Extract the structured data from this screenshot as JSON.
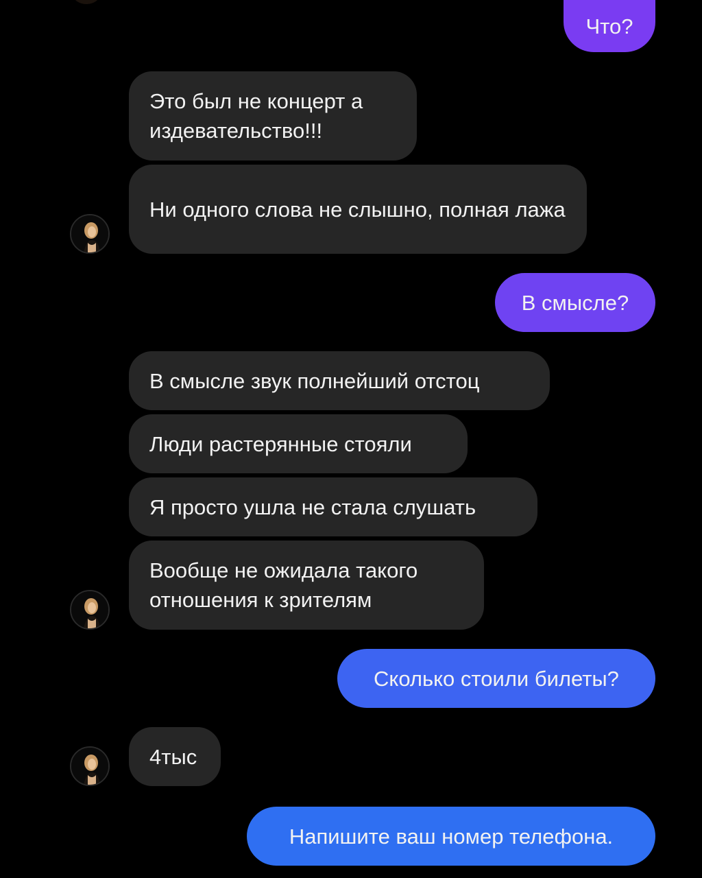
{
  "conversation": {
    "messages": [
      {
        "id": "m1",
        "direction": "outgoing",
        "text": "Что?"
      },
      {
        "id": "m2",
        "direction": "incoming",
        "text": "Это был не концерт а издевательство!!!"
      },
      {
        "id": "m3",
        "direction": "incoming",
        "text": "Ни одного слова не слышно, полная лажа"
      },
      {
        "id": "m4",
        "direction": "outgoing",
        "text": "В смысле?"
      },
      {
        "id": "m5",
        "direction": "incoming",
        "text": "В смысле звук полнейший отстоц"
      },
      {
        "id": "m6",
        "direction": "incoming",
        "text": "Люди растерянные стояли"
      },
      {
        "id": "m7",
        "direction": "incoming",
        "text": "Я просто ушла не стала слушать"
      },
      {
        "id": "m8",
        "direction": "incoming",
        "text": "Вообще не ожидала такого отношения к зрителям"
      },
      {
        "id": "m9",
        "direction": "outgoing",
        "text": "Сколько стоили билеты?"
      },
      {
        "id": "m10",
        "direction": "incoming",
        "text": "4тыс"
      },
      {
        "id": "m11",
        "direction": "outgoing",
        "text": "Напишите ваш номер телефона."
      }
    ]
  },
  "colors": {
    "background": "#000000",
    "incoming_bubble": "#262626",
    "outgoing_gradient_top": "#7b3cf5",
    "outgoing_gradient_bottom": "#2f6ff2",
    "text": "#f2f2f2"
  },
  "icons": {
    "avatar": "contact-avatar-photo"
  }
}
